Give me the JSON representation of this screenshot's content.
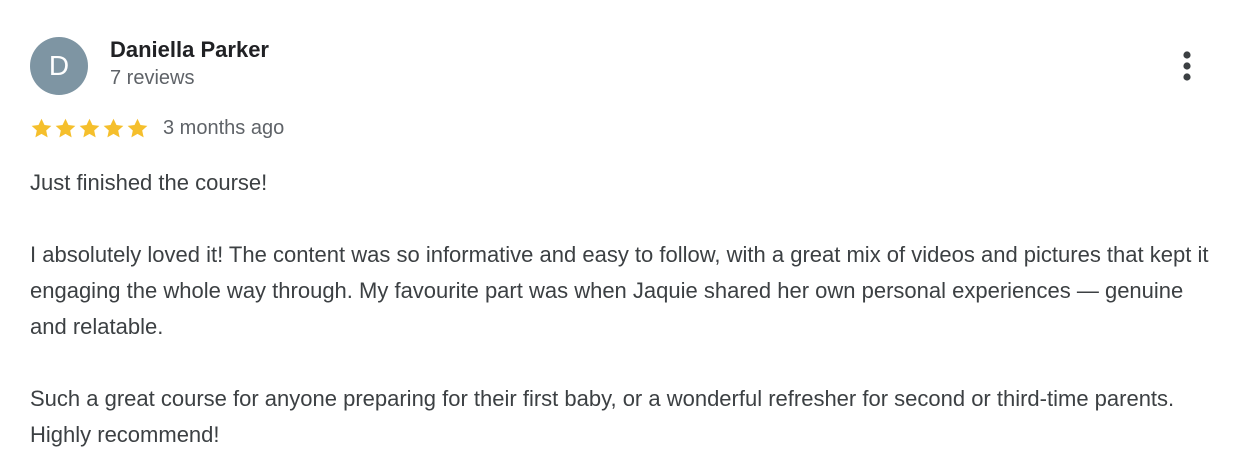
{
  "review": {
    "avatar_letter": "D",
    "avatar_color": "#7e95a3",
    "author_name": "Daniella Parker",
    "author_meta": "7 reviews",
    "rating": 5,
    "rating_max": 5,
    "star_color": "#f5bf2c",
    "date": "3 months ago",
    "paragraphs": [
      "Just finished the course!",
      "I absolutely loved it! The content was so informative and easy to follow, with a great mix of videos and pictures that kept it engaging the whole way through. My favourite part was when Jaquie shared her own personal experiences — genuine and relatable.",
      "Such a great course for anyone preparing for their first baby, or a wonderful refresher for second or third-time parents. Highly recommend!"
    ],
    "more_icon": "more-vert-icon"
  }
}
